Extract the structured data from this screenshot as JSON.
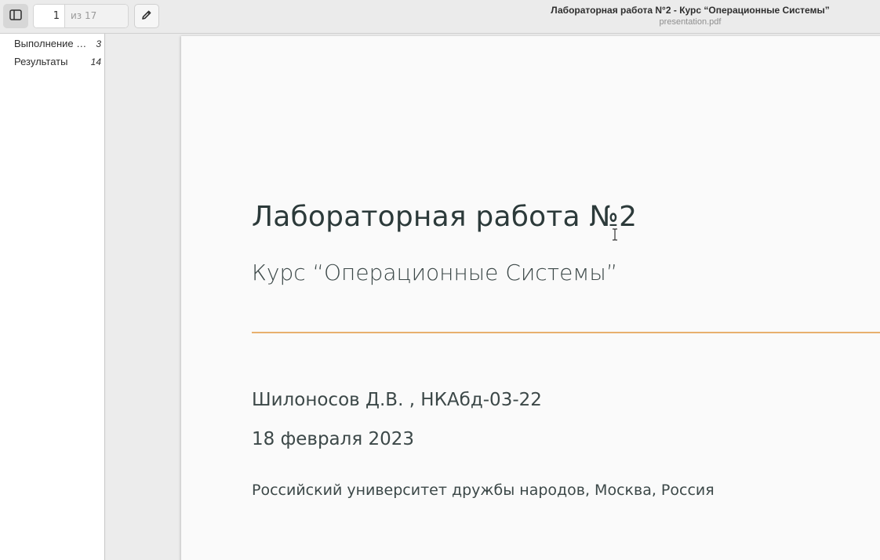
{
  "header": {
    "title": "Лабораторная работа N°2 - Курс “Операционные Системы”",
    "subtitle": "presentation.pdf",
    "page_input_value": "1",
    "page_total": "из 17",
    "sidebar_toggle_icon": "sidebar-toggle-icon",
    "annotate_icon": "pencil-icon"
  },
  "sidebar": {
    "items": [
      {
        "label": "Выполнение лабораторной работы",
        "page": "3"
      },
      {
        "label": "Результаты",
        "page": "14"
      }
    ]
  },
  "slide": {
    "title": "Лабораторная работа №2",
    "subtitle": "Курс “Операционные Системы”",
    "author": "Шилоносов Д.В. , НКАбд-03-22",
    "date": "18 февраля 2023",
    "institution": "Российский университет дружбы народов, Москва, Россия",
    "accent_color": "#e8b06e"
  }
}
